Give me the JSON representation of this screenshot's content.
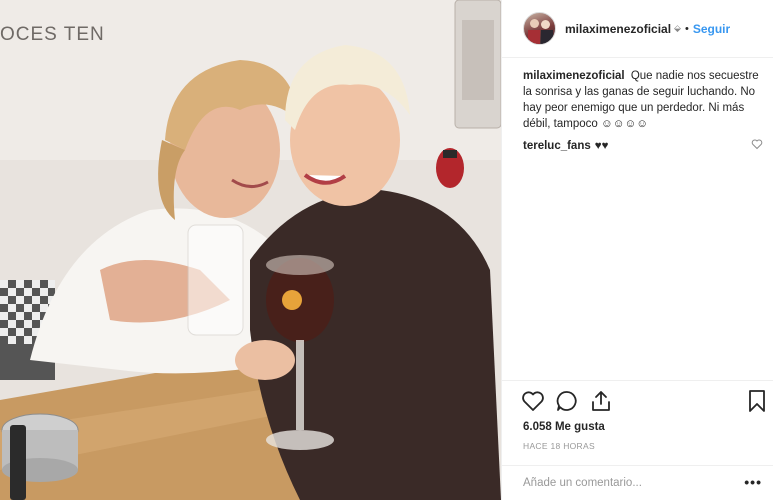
{
  "photo": {
    "wall_text": "OCES TEN",
    "alt_semantic": "two-women-toasting-photo"
  },
  "header": {
    "username": "milaximenezoficial",
    "verified_glyph": "⬙",
    "separator": "•",
    "follow_label": "Seguir"
  },
  "caption": {
    "username": "milaximenezoficial",
    "text": "Que nadie nos secuestre la sonrisa y las ganas de seguir luchando. No hay peor enemigo que un perdedor. Ni más débil, tampoco ☺☺☺☺"
  },
  "comments": [
    {
      "username": "tereluc_fans",
      "text": "♥♥"
    }
  ],
  "actions": {
    "likes": "6.058 Me gusta",
    "time": "HACE 18 HORAS"
  },
  "add_comment": {
    "placeholder": "Añade un comentario...",
    "more_label": "•••"
  },
  "colors": {
    "accent": "#3897f0",
    "text": "#262626",
    "muted": "#999999",
    "border": "#efefef"
  }
}
